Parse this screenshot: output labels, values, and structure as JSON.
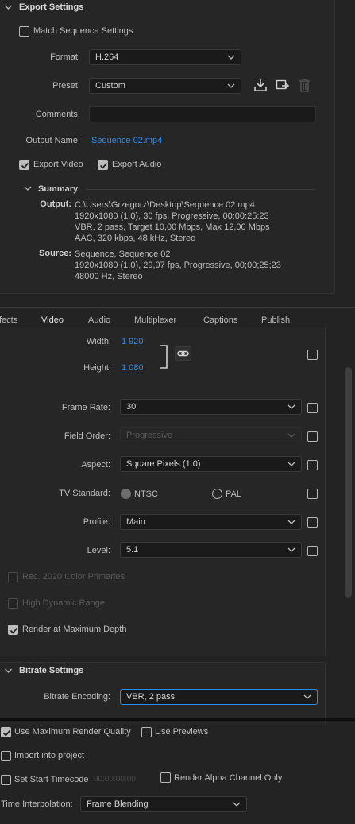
{
  "export_settings": {
    "title": "Export Settings",
    "match_sequence": "Match Sequence Settings",
    "format_label": "Format:",
    "format_value": "H.264",
    "preset_label": "Preset:",
    "preset_value": "Custom",
    "comments_label": "Comments:",
    "comments_value": "",
    "output_name_label": "Output Name:",
    "output_name_value": "Sequence 02.mp4",
    "export_video": "Export Video",
    "export_audio": "Export Audio",
    "summary_title": "Summary",
    "output_label": "Output:",
    "output_lines": [
      "C:\\Users\\Grzegorz\\Desktop\\Sequence 02.mp4",
      "1920x1080 (1,0), 30 fps, Progressive, 00:00:25:23",
      "VBR, 2 pass, Target 10,00 Mbps, Max 12,00 Mbps",
      "AAC, 320 kbps, 48 kHz, Stereo"
    ],
    "source_label": "Source:",
    "source_lines": [
      "Sequence, Sequence 02",
      "1920x1080 (1,0), 29,97 fps, Progressive, 00;00;25;23",
      "48000 Hz, Stereo"
    ]
  },
  "tabs": [
    "fects",
    "Video",
    "Audio",
    "Multiplexer",
    "Captions",
    "Publish"
  ],
  "active_tab": "Video",
  "video": {
    "width_label": "Width:",
    "width_value": "1 920",
    "height_label": "Height:",
    "height_value": "1 080",
    "frame_rate_label": "Frame Rate:",
    "frame_rate_value": "30",
    "field_order_label": "Field Order:",
    "field_order_value": "Progressive",
    "aspect_label": "Aspect:",
    "aspect_value": "Square Pixels (1.0)",
    "tv_standard_label": "TV Standard:",
    "ntsc": "NTSC",
    "pal": "PAL",
    "profile_label": "Profile:",
    "profile_value": "Main",
    "level_label": "Level:",
    "level_value": "5.1",
    "rec2020": "Rec. 2020 Color Primaries",
    "hdr": "High Dynamic Range",
    "max_depth": "Render at Maximum Depth"
  },
  "bitrate": {
    "title": "Bitrate Settings",
    "encoding_label": "Bitrate Encoding:",
    "encoding_value": "VBR, 2 pass"
  },
  "bottom": {
    "max_render": "Use Maximum Render Quality",
    "use_previews": "Use Previews",
    "import_project": "Import into project",
    "start_timecode": "Set Start Timecode",
    "timecode_value": "00:00:00:00",
    "alpha_only": "Render Alpha Channel Only",
    "time_interp_label": "Time Interpolation:",
    "time_interp_value": "Frame Blending"
  },
  "colors": {
    "accent": "#2d8ceb",
    "bg": "#232323"
  }
}
